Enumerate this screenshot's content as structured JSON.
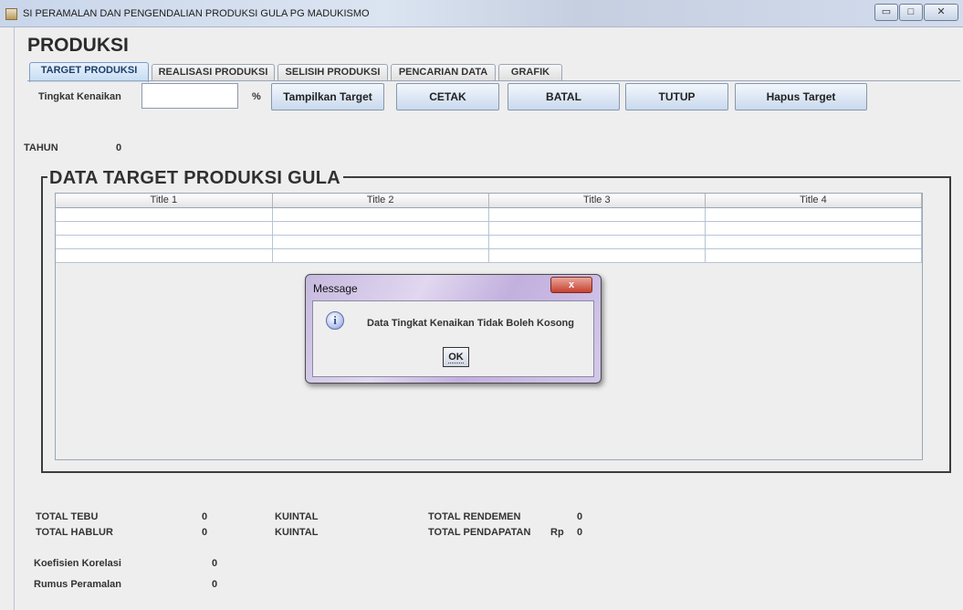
{
  "window": {
    "title": "SI PERAMALAN DAN PENGENDALIAN PRODUKSI GULA PG MADUKISMO",
    "minimize": "▭",
    "maximize": "□",
    "close": "✕"
  },
  "page": {
    "title": "PRODUKSI"
  },
  "tabs": [
    {
      "label": "TARGET PRODUKSI",
      "active": true
    },
    {
      "label": "REALISASI PRODUKSI",
      "active": false
    },
    {
      "label": "SELISIH PRODUKSI",
      "active": false
    },
    {
      "label": "PENCARIAN DATA",
      "active": false
    },
    {
      "label": "GRAFIK",
      "active": false
    }
  ],
  "form": {
    "tingkat_label": "Tingkat Kenaikan",
    "tingkat_value": "",
    "percent": "%",
    "tahun_label": "TAHUN",
    "tahun_value": "0"
  },
  "toolbar": {
    "tampilkan": "Tampilkan Target",
    "cetak": "CETAK",
    "batal": "BATAL",
    "tutup": "TUTUP",
    "hapus": "Hapus Target"
  },
  "data_section": {
    "title": "DATA TARGET PRODUKSI GULA",
    "columns": [
      "Title 1",
      "Title 2",
      "Title 3",
      "Title 4"
    ],
    "rows": [
      [
        "",
        "",
        "",
        ""
      ],
      [
        "",
        "",
        "",
        ""
      ],
      [
        "",
        "",
        "",
        ""
      ],
      [
        "",
        "",
        "",
        ""
      ]
    ]
  },
  "summary": {
    "total_tebu_label": "TOTAL  TEBU",
    "total_tebu_value": "0",
    "total_tebu_unit": "KUINTAL",
    "total_hablur_label": "TOTAL HABLUR",
    "total_hablur_value": "0",
    "total_hablur_unit": "KUINTAL",
    "total_rendemen_label": "TOTAL RENDEMEN",
    "total_rendemen_value": "0",
    "total_pendapatan_label": "TOTAL PENDAPATAN",
    "rp": "Rp",
    "total_pendapatan_value": "0",
    "koefisien_label": "Koefisien Korelasi",
    "koefisien_value": "0",
    "rumus_label": "Rumus Peramalan",
    "rumus_value": "0"
  },
  "dialog": {
    "title": "Message",
    "close": "x",
    "icon": "i",
    "message": "Data Tingkat Kenaikan Tidak Boleh Kosong",
    "ok": "OK"
  }
}
